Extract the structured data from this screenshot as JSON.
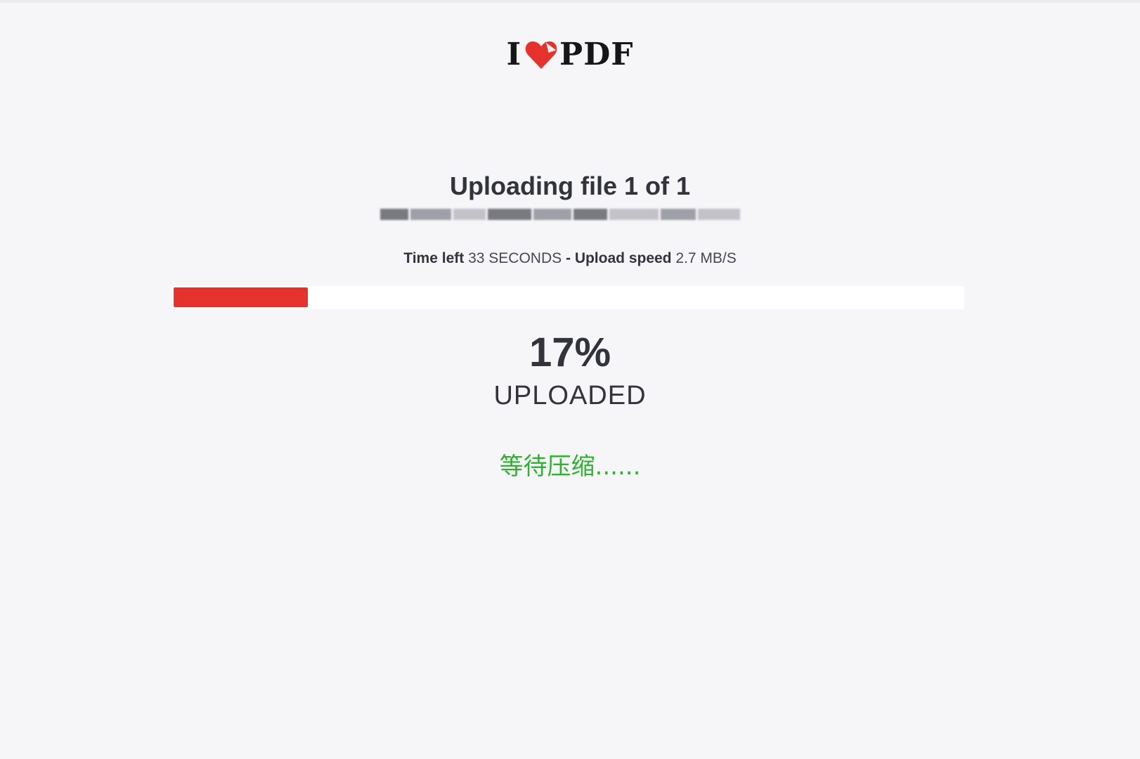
{
  "logo": {
    "prefix": "I",
    "suffix": "PDF",
    "heart_color": "#e5322d"
  },
  "upload": {
    "title": "Uploading file 1 of 1",
    "time_left_label": "Time left",
    "time_left_value": "33 SECONDS",
    "separator": "-",
    "speed_label": "Upload speed",
    "speed_value": "2.7 MB/S",
    "progress_percent": 17,
    "percent_text": "17%",
    "uploaded_label": "UPLOADED",
    "status_text": "等待压缩......",
    "status_color": "#2fb02f",
    "accent_color": "#e5322d"
  }
}
